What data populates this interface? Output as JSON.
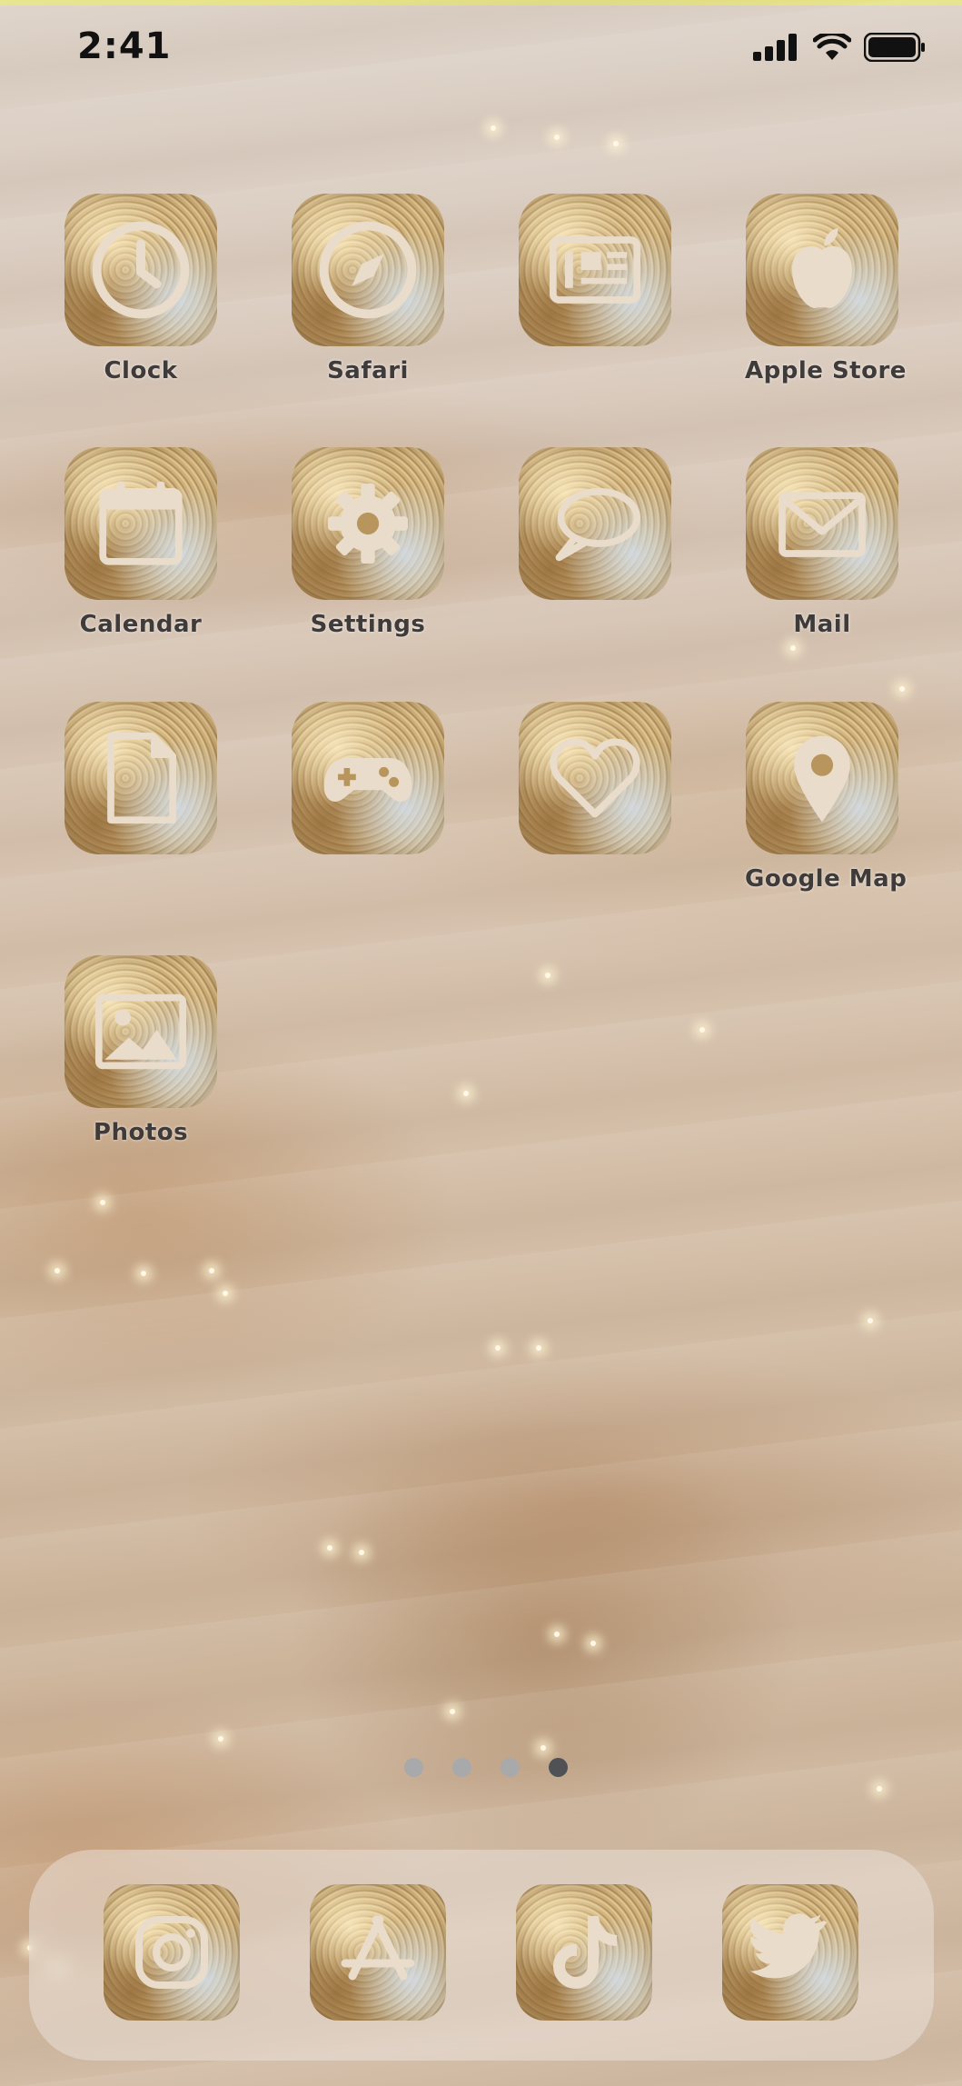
{
  "status_bar": {
    "time": "2:41"
  },
  "apps": [
    {
      "id": "clock",
      "label": "Clock",
      "icon": "clock-icon"
    },
    {
      "id": "safari",
      "label": "Safari",
      "icon": "compass-icon"
    },
    {
      "id": "news",
      "label": "",
      "icon": "newspaper-icon"
    },
    {
      "id": "apple-store",
      "label": "Apple Store",
      "icon": "apple-logo-icon"
    },
    {
      "id": "calendar",
      "label": "Calendar",
      "icon": "calendar-icon"
    },
    {
      "id": "settings",
      "label": "Settings",
      "icon": "gear-icon"
    },
    {
      "id": "messages",
      "label": "",
      "icon": "speech-bubble-icon"
    },
    {
      "id": "mail",
      "label": "Mail",
      "icon": "envelope-icon"
    },
    {
      "id": "files",
      "label": "",
      "icon": "document-icon"
    },
    {
      "id": "games",
      "label": "",
      "icon": "gamepad-icon"
    },
    {
      "id": "health",
      "label": "",
      "icon": "heart-icon"
    },
    {
      "id": "google-map",
      "label": "Google Map",
      "icon": "map-pin-icon"
    },
    {
      "id": "photos",
      "label": "Photos",
      "icon": "image-icon"
    }
  ],
  "page_indicator": {
    "pages": 4,
    "current": 4
  },
  "dock": [
    {
      "id": "instagram",
      "icon": "instagram-icon"
    },
    {
      "id": "app-store",
      "icon": "app-store-icon"
    },
    {
      "id": "tiktok",
      "icon": "tiktok-icon"
    },
    {
      "id": "twitter",
      "icon": "twitter-bird-icon"
    }
  ],
  "colors": {
    "icon_glyph": "#eadccb",
    "label_text": "#3e3b3a",
    "dot_inactive": "#a7a9ab",
    "dot_active": "#4f5155"
  }
}
